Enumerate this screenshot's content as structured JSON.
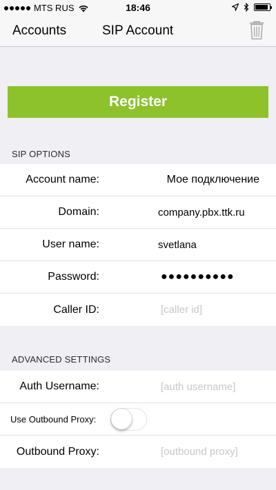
{
  "status_bar": {
    "carrier": "MTS RUS",
    "time": "18:46",
    "signal_bars": 5,
    "battery_level": 0.9
  },
  "nav": {
    "back_label": "Accounts",
    "title": "SIP Account",
    "trash_icon": "trash-icon"
  },
  "register": {
    "label": "Register",
    "color": "#8dc22b"
  },
  "sip_options": {
    "header": "SIP OPTIONS",
    "account_name": {
      "label": "Account name:",
      "value": "Мое подключение"
    },
    "domain": {
      "label": "Domain:",
      "value": "company.pbx.ttk.ru"
    },
    "user_name": {
      "label": "User name:",
      "value": "svetlana"
    },
    "password": {
      "label": "Password:",
      "value": "●●●●●●●●●●"
    },
    "caller_id": {
      "label": "Caller ID:",
      "placeholder": "[caller id]"
    }
  },
  "advanced": {
    "header": "ADVANCED SETTINGS",
    "auth_username": {
      "label": "Auth Username:",
      "placeholder": "[auth username]"
    },
    "use_outbound_proxy": {
      "label": "Use Outbound Proxy:",
      "enabled": false
    },
    "outbound_proxy": {
      "label": "Outbound Proxy:",
      "placeholder": "[outbound proxy]"
    }
  }
}
